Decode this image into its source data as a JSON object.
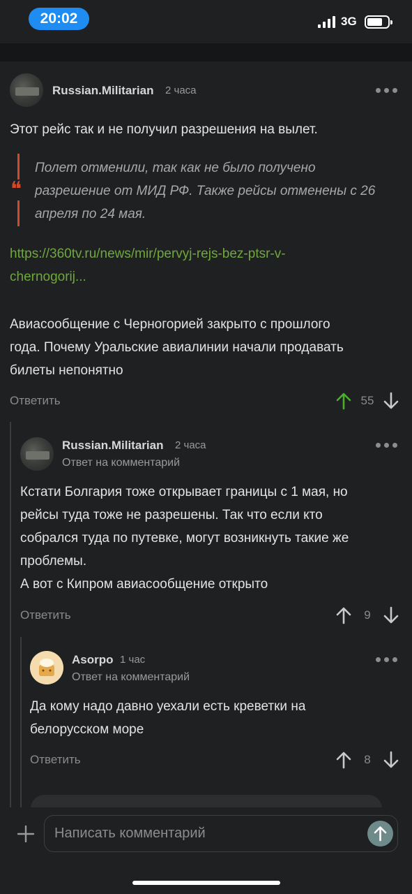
{
  "status_bar": {
    "time": "20:02",
    "network": "3G"
  },
  "comments": [
    {
      "author": "Russian.Militarian",
      "time": "2 часа",
      "text_lines": [
        "Этот рейс так и не получил разрешения на вылет."
      ],
      "quote_lines": [
        "Полет отменили, так как не было получено",
        "разрешение от МИД РФ. Также рейсы отменены с 26",
        "апреля по 24 мая."
      ],
      "link_lines": [
        "https://360tv.ru/news/mir/pervyj-rejs-bez-ptsr-v-",
        "chernogorij..."
      ],
      "text2_lines": [
        "Авиасообщение с Черногорией закрыто с прошлого",
        "года. Почему Уральские авиалинии начали продавать",
        "билеты непонятно"
      ],
      "reply_label": "Ответить",
      "votes": "55"
    },
    {
      "author": "Russian.Militarian",
      "time": "2 часа",
      "reply_to": "Ответ на комментарий",
      "text_lines": [
        "Кстати Болгария тоже открывает границы с 1 мая, но",
        "рейсы туда тоже не разрешены. Так что если кто",
        "собрался туда по путевке, могут возникнуть  такие же",
        "проблемы.",
        "А вот с Кипром авиасообщение открыто"
      ],
      "reply_label": "Ответить",
      "votes": "9"
    },
    {
      "author": "Asorpo",
      "time": "1 час",
      "reply_to": "Ответ на комментарий",
      "text_lines": [
        "Да кому надо давно уехали есть креветки на",
        "белорусском море"
      ],
      "reply_label": "Ответить",
      "votes": "8"
    }
  ],
  "composer": {
    "placeholder": "Написать комментарий"
  },
  "colors": {
    "upvote_active": "#4caf2a",
    "quote_accent": "#d04a2c",
    "link": "#6fa83b",
    "time_pill": "#1e8cf0"
  }
}
